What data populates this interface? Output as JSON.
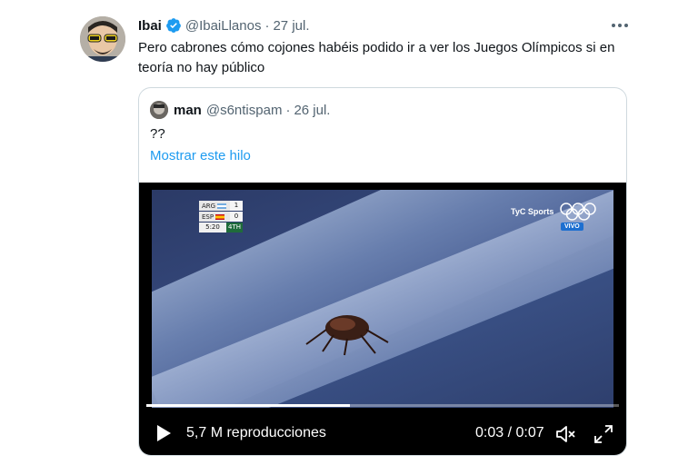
{
  "tweet": {
    "author_name": "Ibai",
    "handle": "@IbaiLlanos",
    "date": "27 jul.",
    "text": "Pero cabrones cómo cojones habéis podido ir a ver los Juegos Olímpicos si en teoría no hay público"
  },
  "quoted": {
    "author_name": "man",
    "handle": "@s6ntispam",
    "date": "26 jul.",
    "text": "??",
    "thread_link": "Mostrar este hilo"
  },
  "video": {
    "scoreboard": {
      "team1": "ARG",
      "score1": "1",
      "team2": "ESP",
      "score2": "0",
      "clock": "5:20",
      "period": "4TH"
    },
    "broadcaster": "TyC Sports",
    "live_badge": "VIVO",
    "views": "5,7 M reproducciones",
    "current_time": "0:03",
    "separator": "/",
    "duration": "0:07",
    "progress": 0.43
  },
  "colors": {
    "accent": "#1d9bf0",
    "muted": "#536471",
    "border": "#cfd9de"
  },
  "icons": [
    "verified-badge-icon",
    "more-icon",
    "play-icon",
    "volume-muted-icon",
    "fullscreen-icon",
    "olympic-rings-icon"
  ]
}
